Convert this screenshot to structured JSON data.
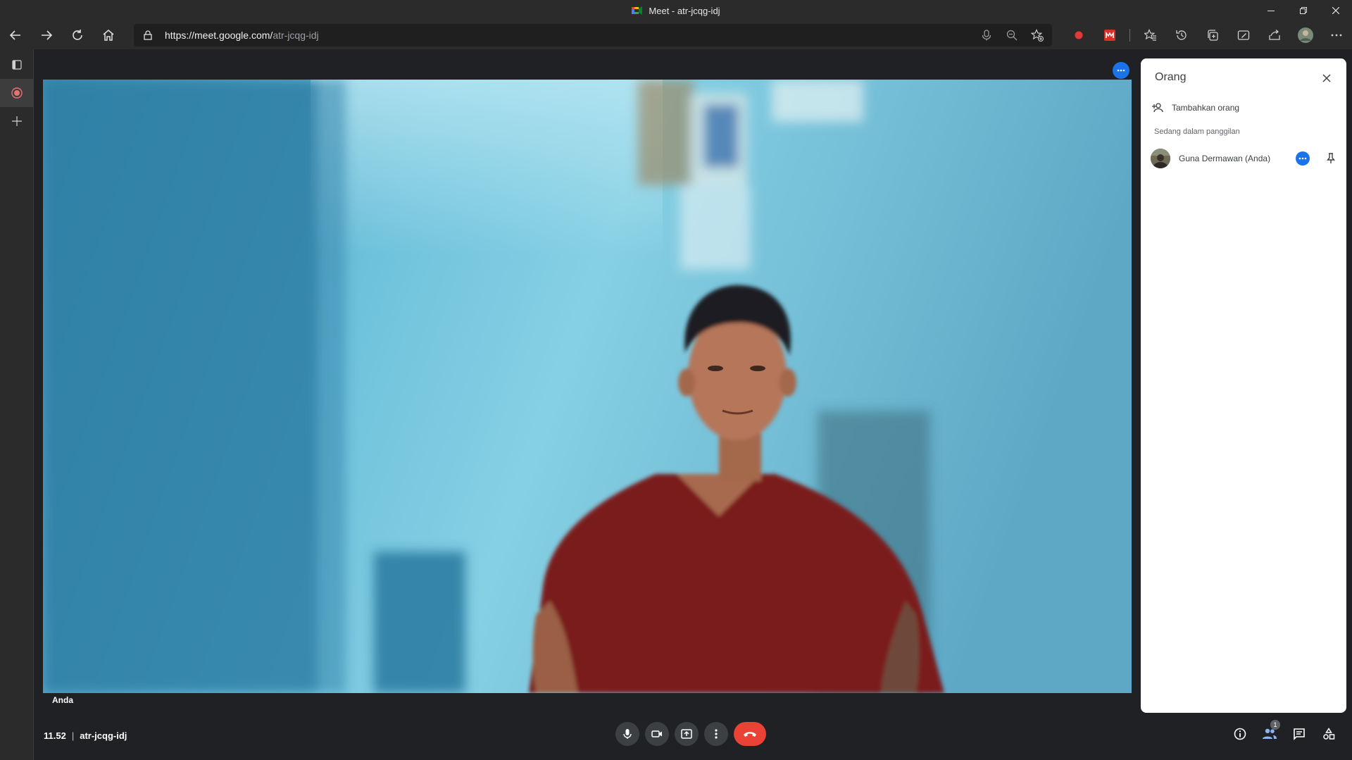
{
  "window": {
    "title": "Meet - atr-jcqg-idj",
    "controls": [
      "minimize",
      "restore",
      "close"
    ]
  },
  "browser": {
    "url_host": "https://meet.google.com/",
    "url_path": "atr-jcqg-idj",
    "icons": [
      "back-icon",
      "forward-icon",
      "refresh-icon",
      "home-icon",
      "lock-icon",
      "microphone-icon",
      "zoom-out-icon",
      "add-favorite-icon",
      "record-extension-icon",
      "extension-icon",
      "favorites-icon",
      "history-icon",
      "collections-icon",
      "web-capture-icon",
      "share-icon",
      "profile-avatar",
      "menu-icon"
    ]
  },
  "meet": {
    "tile_name": "Anda",
    "time": "11.52",
    "separator": "|",
    "meeting_code": "atr-jcqg-idj",
    "participants_count": "1"
  },
  "panel": {
    "title": "Orang",
    "add_people": "Tambahkan orang",
    "section_label": "Sedang dalam panggilan",
    "participants": [
      {
        "name": "Guna Dermawan (Anda)"
      }
    ]
  },
  "colors": {
    "accent": "#1a73e8",
    "end_call": "#ea4335",
    "background": "#202124",
    "video_wall": "#4fa4c6",
    "shirt": "#7a1e1c"
  }
}
